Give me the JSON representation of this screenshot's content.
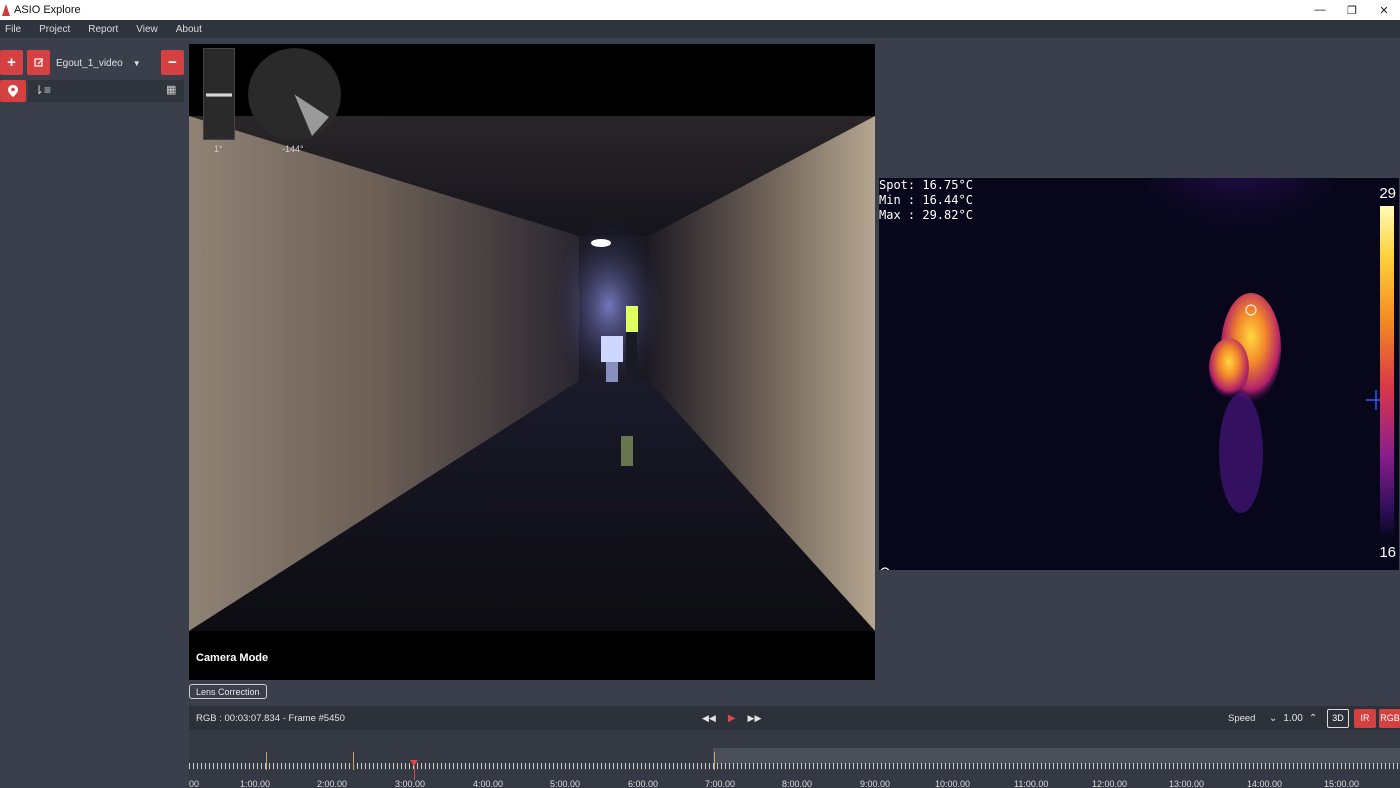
{
  "window": {
    "title": "ASIO Explore",
    "controls": {
      "minimize": "—",
      "restore": "❐",
      "close": "✕"
    }
  },
  "menu": [
    "File",
    "Project",
    "Report",
    "View",
    "About"
  ],
  "sidebar": {
    "add_icon": "plus-icon",
    "edit_icon": "edit-icon",
    "remove_icon": "minus-icon",
    "selected_video": "Egout_1_video",
    "location_icon": "map-pin-icon",
    "sort_icon": "sort-icon",
    "grid_icon": "grid-icon"
  },
  "video": {
    "tilt_label": "1°",
    "heading_label": "-144°",
    "mode_label": "Camera Mode",
    "lens_button": "Lens Correction"
  },
  "thermal": {
    "readout": "Spot: 16.75°C\nMin : 16.44°C\nMax : 29.82°C",
    "scale_max": "29",
    "scale_min": "16"
  },
  "playback": {
    "frame_info": "RGB : 00:03:07.834 - Frame #5450",
    "speed_label": "Speed",
    "speed_value": "1.00",
    "mode_3d": "3D",
    "mode_ir": "IR",
    "mode_rgb": "RGB"
  },
  "timeline": {
    "ticks": [
      "00",
      "1:00.00",
      "2:00.00",
      "3:00.00",
      "4:00.00",
      "5:00.00",
      "6:00.00",
      "7:00.00",
      "8:00.00",
      "9:00.00",
      "10:00.00",
      "11:00.00",
      "12:00.00",
      "13:00.00",
      "14:00.00",
      "15:00.00"
    ]
  },
  "colors": {
    "accent": "#d54141",
    "panel_bg": "#3a3f4b"
  }
}
